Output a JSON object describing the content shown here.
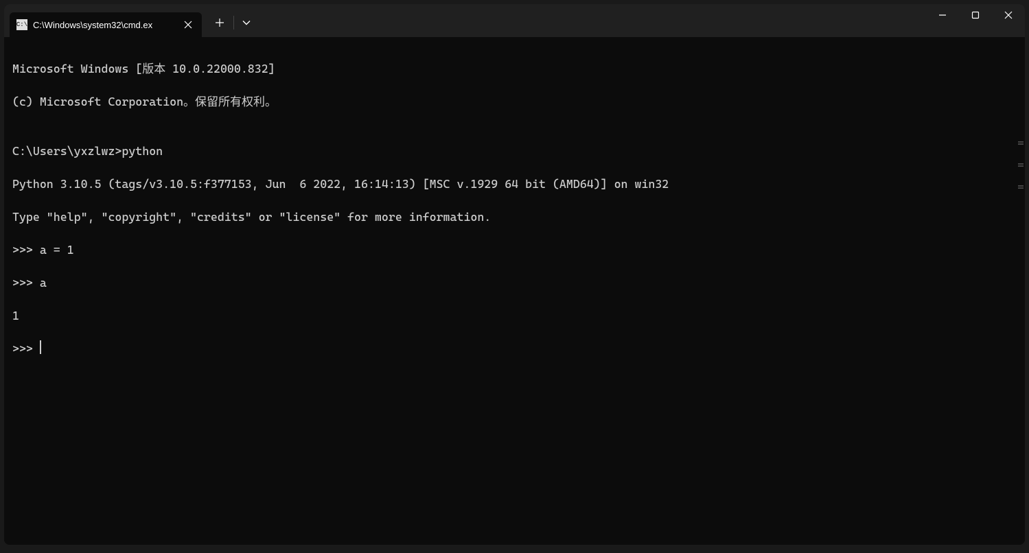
{
  "tab": {
    "title": "C:\\Windows\\system32\\cmd.ex",
    "icon_label": "cmd-icon"
  },
  "terminal": {
    "lines": [
      "Microsoft Windows [版本 10.0.22000.832]",
      "(c) Microsoft Corporation。保留所有权利。",
      "",
      "C:\\Users\\yxzlwz>python",
      "Python 3.10.5 (tags/v3.10.5:f377153, Jun  6 2022, 16:14:13) [MSC v.1929 64 bit (AMD64)] on win32",
      "Type \"help\", \"copyright\", \"credits\" or \"license\" for more information.",
      ">>> a = 1",
      ">>> a",
      "1"
    ],
    "prompt": ">>> "
  }
}
